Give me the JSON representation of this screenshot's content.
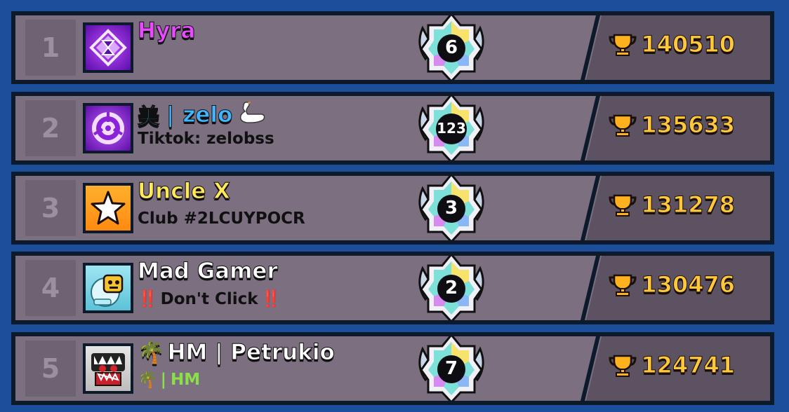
{
  "leaderboard": {
    "rows": [
      {
        "rank": "1",
        "name": "Hyra",
        "name_color": "#e94aff",
        "subtitle": "",
        "level": "6",
        "trophies": "140510",
        "avatar_icon": "hourglass-diamond-icon",
        "avatar_bg": "#7a1fd0"
      },
      {
        "rank": "2",
        "name_prefix": "美",
        "name_sep": "|",
        "name": "zelo",
        "name_suffix_icon": "swan-icon",
        "name_color": "#3fb6ff",
        "subtitle": "Tiktok: zelobss",
        "level": "123",
        "trophies": "135633",
        "avatar_icon": "circular-emblem-icon",
        "avatar_bg": "#8a23d8"
      },
      {
        "rank": "3",
        "name": "Uncle X",
        "name_color": "#ffe85a",
        "subtitle": "Club #2LCUYPOCR",
        "level": "3",
        "trophies": "131278",
        "avatar_icon": "star-icon",
        "avatar_bg": "#ff9a1f"
      },
      {
        "rank": "4",
        "name": "Mad Gamer",
        "name_color": "#ffffff",
        "subtitle_prefix": "‼️",
        "subtitle": "Don't Click",
        "subtitle_suffix": "‼️",
        "level": "2",
        "trophies": "130476",
        "avatar_icon": "robot-brawler-icon",
        "avatar_bg": "#7ed7e8"
      },
      {
        "rank": "5",
        "name_prefix": "🌴",
        "name": "HM | Petrukio",
        "name_color": "#ffffff",
        "subtitle_prefix": "🌴",
        "subtitle_sep": "|",
        "subtitle": "HM",
        "subtitle_color": "#8be04a",
        "level": "7",
        "trophies": "124741",
        "avatar_icon": "shark-brawler-icon",
        "avatar_bg": "#d8d8d8"
      }
    ]
  }
}
